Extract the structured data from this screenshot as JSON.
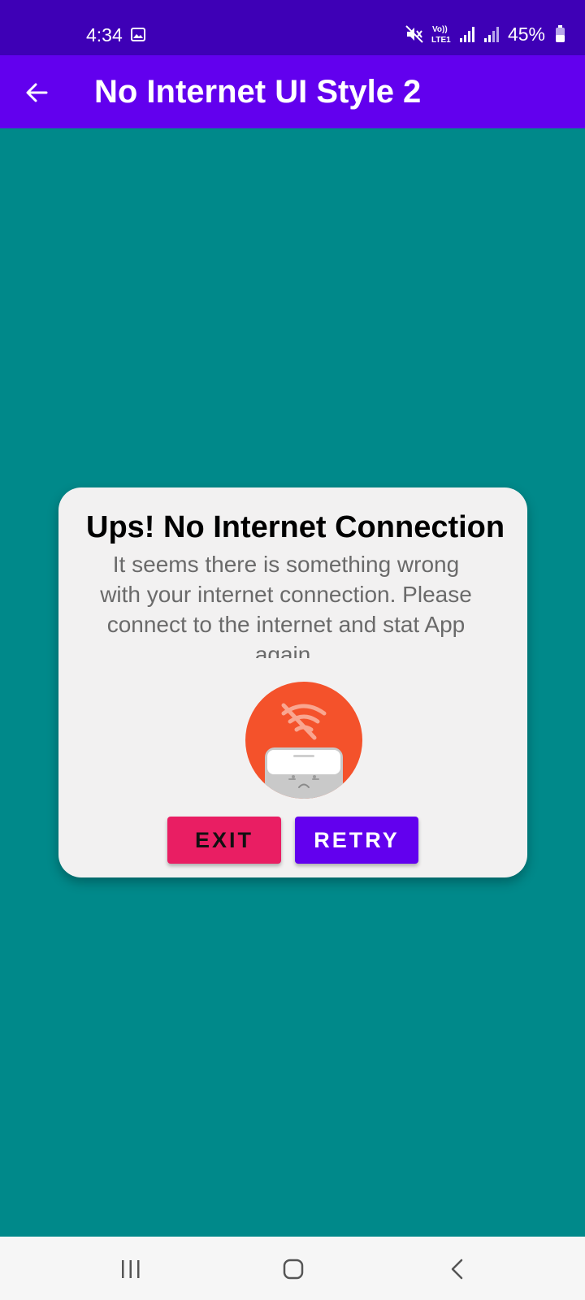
{
  "status_bar": {
    "time": "4:34",
    "battery": "45%",
    "icons": [
      "gallery-icon",
      "mute-icon",
      "volte-icon",
      "signal-icon",
      "signal-icon",
      "battery-icon"
    ],
    "volte_top": "Vo))",
    "volte_bottom": "LTE1"
  },
  "app_bar": {
    "back_icon": "arrow-left-icon",
    "title": "No Internet UI Style 2"
  },
  "dialog": {
    "title": "Ups! No Internet Connection",
    "message": "It seems there is something wrong with your internet connection. Please connect to the internet and stat App again.",
    "illustration": "no-wifi-sad-device-icon",
    "exit_label": "EXIT",
    "retry_label": "RETRY"
  },
  "nav_bar": {
    "recents_icon": "recents-icon",
    "home_icon": "home-icon",
    "back_icon": "chevron-left-icon"
  },
  "colors": {
    "background": "#00898a",
    "status_bar": "#3e00b6",
    "app_bar": "#6200ee",
    "dialog": "#f2f1f1",
    "exit": "#e91e63",
    "retry": "#6200ee",
    "illustration": "#f4522b"
  }
}
